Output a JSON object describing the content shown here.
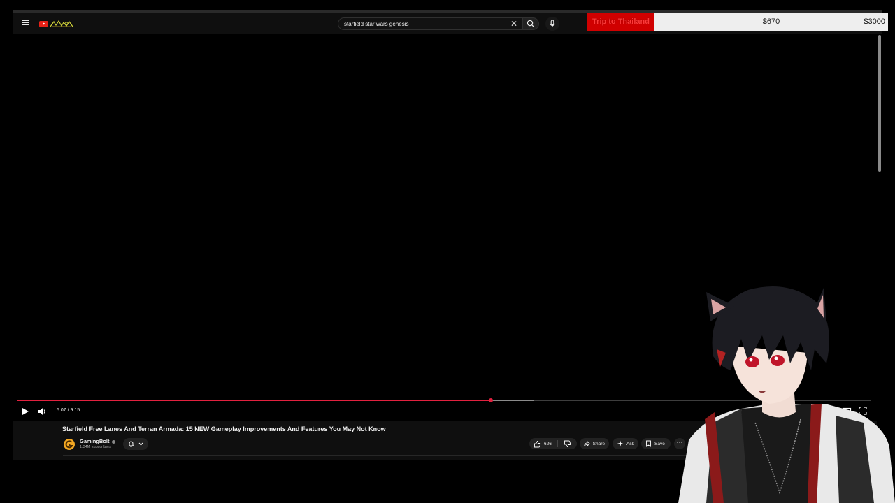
{
  "masthead": {
    "search_value": "starfield star wars genesis",
    "icons": [
      "menu-icon",
      "youtube-logo",
      "clear-icon",
      "search-icon",
      "mic-icon"
    ]
  },
  "player": {
    "time_display": "5:07 / 9:15",
    "progress_played": 0.555,
    "progress_buffered": 0.605,
    "accent_color": "#e2213f"
  },
  "video": {
    "title": "Starfield Free Lanes And Terran Armada: 15 NEW Gameplay Improvements And Features You May Not Know",
    "channel_name": "GamingBolt",
    "subscribers": "1.34M subscribers",
    "actions": {
      "like_count": "626",
      "share_label": "Share",
      "ask_label": "Ask",
      "save_label": "Save"
    }
  },
  "donation_goal": {
    "label": "Trip to Thailand",
    "current": "$670",
    "target": "$3000",
    "label_bg": "#d00000"
  }
}
